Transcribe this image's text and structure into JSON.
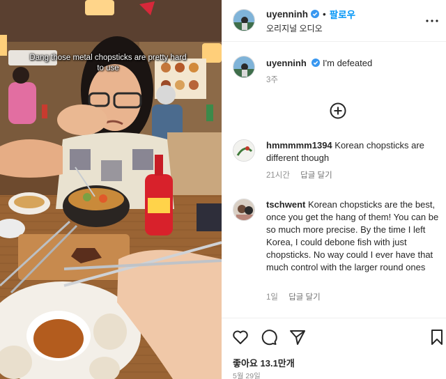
{
  "video": {
    "caption": "Dang those metal chopsticks are pretty hard to use"
  },
  "header": {
    "username": "uyenninh",
    "separator": "•",
    "follow_label": "팔로우",
    "audio_label": "오리지널 오디오"
  },
  "caption_post": {
    "username": "uyenninh",
    "text": "I'm defeated",
    "time": "3주"
  },
  "comments": [
    {
      "username": "hmmmmm1394",
      "text": "Korean chopsticks are different though",
      "time": "21시간",
      "reply_label": "답글 달기"
    },
    {
      "username": "tschwent",
      "text": "Korean chopsticks are the best, once you get the hang of them! You can be so much more precise. By the time I left Korea, I could debone fish with just chopsticks. No way could I ever have that much control with the larger round ones",
      "time": "1일",
      "reply_label": "답글 달기"
    }
  ],
  "footer": {
    "likes_label": "좋아요 13.1만개",
    "date": "5월 29일"
  },
  "icons": {
    "verified": "verified-badge-icon",
    "more": "more-options-icon",
    "load_more": "plus-circle-icon",
    "like": "heart-icon",
    "comment": "comment-bubble-icon",
    "share": "paper-plane-icon",
    "save": "bookmark-icon"
  },
  "colors": {
    "accent": "#0095f6",
    "verified": "#3897f0",
    "secondary_text": "#8e8e8e"
  }
}
